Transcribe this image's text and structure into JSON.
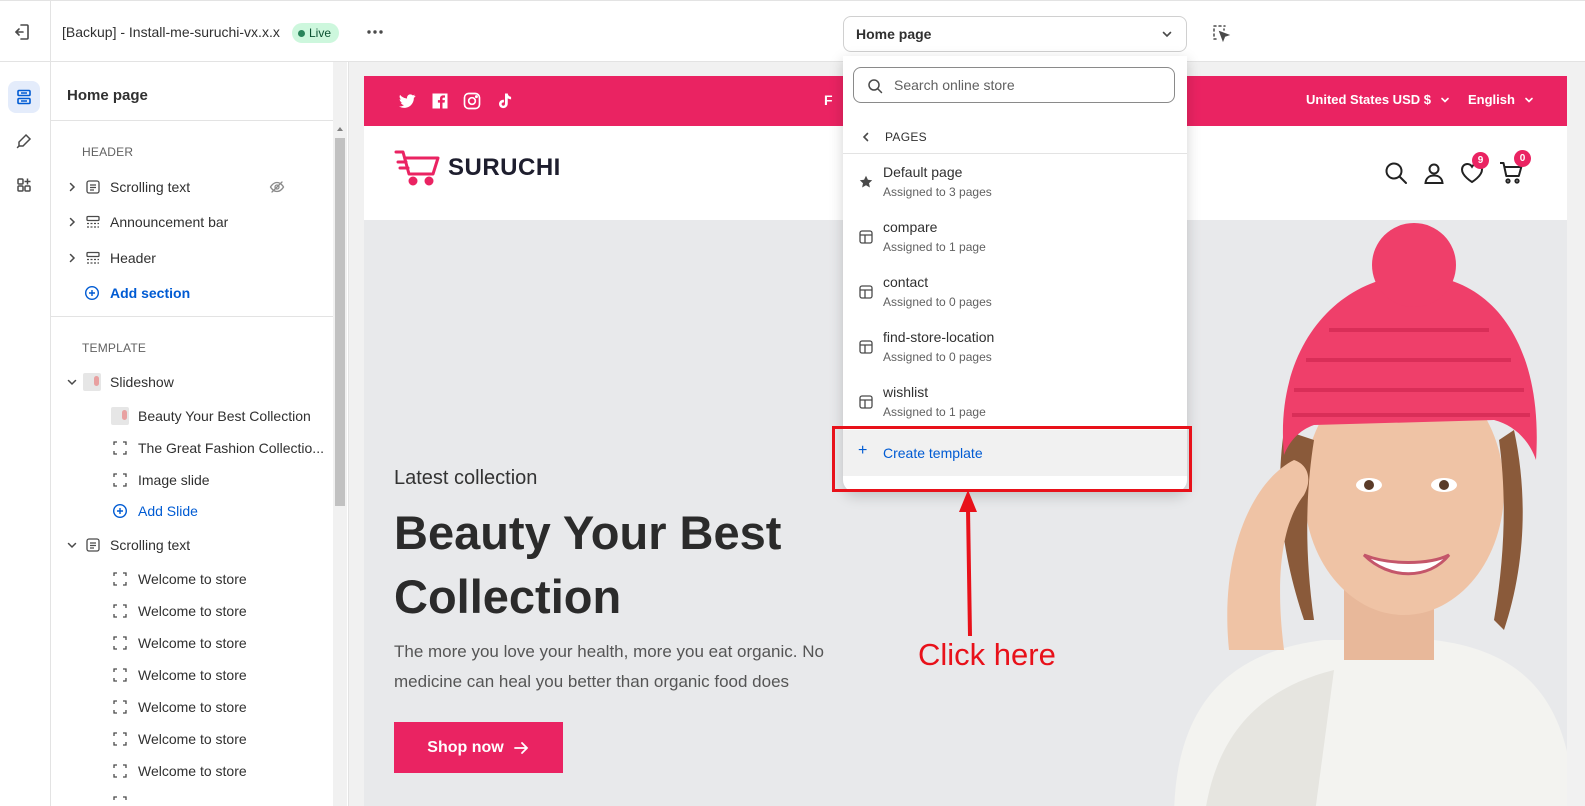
{
  "topbar": {
    "exit_icon": "exit-icon",
    "theme_name": "[Backup] - Install-me-suruchi-vx.x.x",
    "live_badge": "Live",
    "more_icon": "more-horizontal-icon",
    "page_select": "Home page",
    "inspector_icon": "select-cursor-icon"
  },
  "rail": {
    "items": [
      "sections-icon",
      "theme-settings-icon",
      "app-embeds-icon"
    ]
  },
  "sidebar": {
    "title": "Home page",
    "header_group": "HEADER",
    "header_sections": [
      "Scrolling text",
      "Announcement bar",
      "Header"
    ],
    "add_section": "Add section",
    "template_group": "TEMPLATE",
    "slideshow": {
      "label": "Slideshow",
      "slides": [
        "Beauty Your Best Collection",
        "The Great Fashion Collectio...",
        "Image slide"
      ],
      "add_slide": "Add Slide"
    },
    "scrolling_text": {
      "label": "Scrolling text",
      "items": [
        "Welcome to store",
        "Welcome to store",
        "Welcome to store",
        "Welcome to store",
        "Welcome to store",
        "Welcome to store",
        "Welcome to store"
      ]
    }
  },
  "dropdown": {
    "search_placeholder": "Search online store",
    "back_label": "PAGES",
    "items": [
      {
        "name": "Default page",
        "sub": "Assigned to 3 pages",
        "icon": "star-icon"
      },
      {
        "name": "compare",
        "sub": "Assigned to 1 page",
        "icon": "template-icon"
      },
      {
        "name": "contact",
        "sub": "Assigned to 0 pages",
        "icon": "template-icon"
      },
      {
        "name": "find-store-location",
        "sub": "Assigned to 0 pages",
        "icon": "template-icon"
      },
      {
        "name": "wishlist",
        "sub": "Assigned to 1 page",
        "icon": "template-icon"
      }
    ],
    "create_template": "Create template"
  },
  "store": {
    "promo_partial": "F",
    "currency": "United States USD $",
    "language": "English",
    "logo_text": "SURUCHI",
    "wishlist_count": "9",
    "cart_count": "0",
    "hero": {
      "eyebrow": "Latest collection",
      "title": "Beauty Your Best Collection",
      "description": "The more you love your health, more you eat organic. No medicine can heal you better than organic food does",
      "button": "Shop now"
    }
  },
  "annotation": {
    "text": "Click here"
  },
  "colors": {
    "brand": "#ea2362",
    "link": "#005bd3",
    "annotation": "#e8111a",
    "live": "#29845a"
  }
}
